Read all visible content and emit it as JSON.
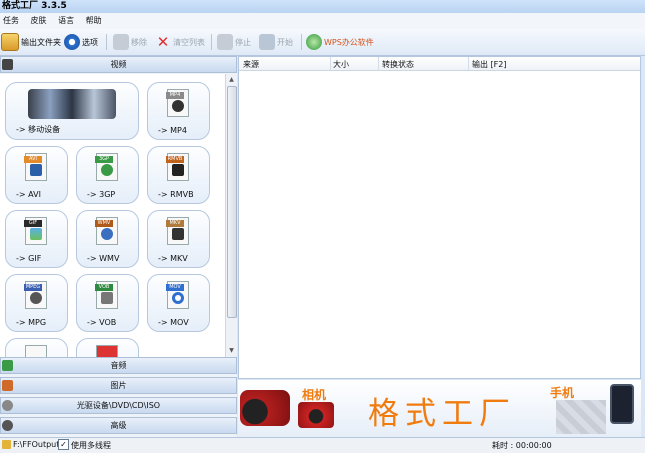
{
  "window": {
    "title": "格式工厂 3.3.5"
  },
  "menu": [
    "任务",
    "皮肤",
    "语言",
    "帮助"
  ],
  "toolbar": {
    "output_folder": "输出文件夹",
    "options": "选项",
    "remove": "移除",
    "clear_list": "清空列表",
    "stop": "停止",
    "start": "开始",
    "wps": "WPS办公软件"
  },
  "categories": {
    "video": "视频",
    "audio": "音频",
    "picture": "图片",
    "rom": "光驱设备\\DVD\\CD\\ISO",
    "advanced": "高级"
  },
  "tiles": [
    {
      "label": "-> 移动设备",
      "tag": "",
      "color": "#5b8fd0"
    },
    {
      "label": "-> MP4",
      "tag": "MP4",
      "color": "#8a8a8a"
    },
    {
      "label": "-> AVI",
      "tag": "AVI",
      "color": "#e38a2b"
    },
    {
      "label": "-> 3GP",
      "tag": "3GP",
      "color": "#3a9a45"
    },
    {
      "label": "-> RMVB",
      "tag": "RMVB",
      "color": "#c0641c"
    },
    {
      "label": "-> GIF",
      "tag": "GIF",
      "color": "#2a2a2a"
    },
    {
      "label": "-> WMV",
      "tag": "WMV",
      "color": "#b05a1a"
    },
    {
      "label": "-> MKV",
      "tag": "MKV",
      "color": "#b07a3a"
    },
    {
      "label": "-> MPG",
      "tag": "MPEG",
      "color": "#3a5fb0"
    },
    {
      "label": "-> VOB",
      "tag": "VOB",
      "color": "#2e8a3e"
    },
    {
      "label": "-> MOV",
      "tag": "MOV",
      "color": "#2f6fd0"
    }
  ],
  "list_headers": [
    "来源",
    "大小",
    "转换状态",
    "输出 [F2]"
  ],
  "banner": {
    "brand": "格式工厂",
    "camera_label": "相机",
    "phone_label": "手机"
  },
  "status": {
    "output_path": "F:\\FFOutput",
    "multithread_label": "使用多线程",
    "multithread_checked": true,
    "time": "耗时 : 00:00:00"
  },
  "colors": {
    "accent": "#f07c10",
    "panel": "#dbe7f5"
  }
}
